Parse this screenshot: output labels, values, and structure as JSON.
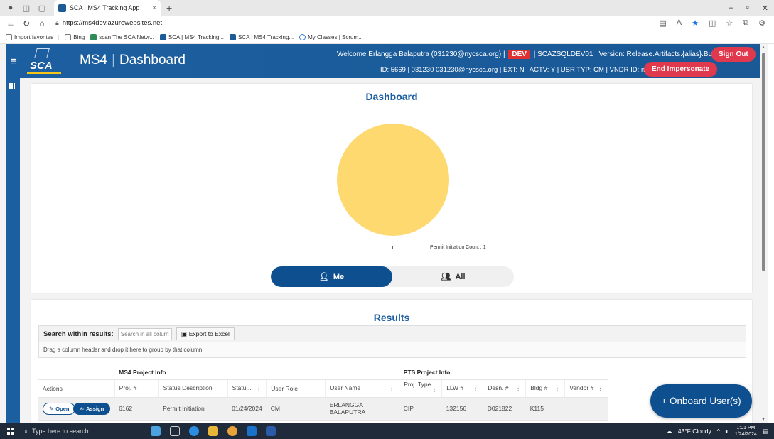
{
  "browser": {
    "tab_title": "SCA | MS4 Tracking App",
    "tab_close": "×",
    "new_tab": "+",
    "url": "https://ms4dev.azurewebsites.net",
    "favorites": [
      {
        "label": "Import favorites"
      },
      {
        "label": "Bing"
      },
      {
        "label": "scan The SCA Netw..."
      },
      {
        "label": "SCA | MS4 Tracking..."
      },
      {
        "label": "SCA | MS4 Tracking..."
      },
      {
        "label": "My Classes | Scrum..."
      }
    ]
  },
  "header": {
    "brand_left": "MS4",
    "brand_sep": "|",
    "brand_right": "Dashboard",
    "logo_text": "SCA",
    "welcome_pre": "Welcome Erlangga Balaputra (031230@nycsca.org) |",
    "env_badge": "DEV",
    "welcome_post": "| SCAZSQLDEV01 | Version: Release.Artifacts.{alias}.BuildNumber",
    "id_line": "ID: 5669 | 031230 031230@nycsca.org | EXT: N | ACTV: Y | USR TYP: CM | VNDR ID: null",
    "sign_out": "Sign Out",
    "end_impersonate": "End Impersonate"
  },
  "dashboard": {
    "title": "Dashboard",
    "toggle_me": "Me",
    "toggle_all": "All"
  },
  "chart_data": {
    "type": "pie",
    "title": "",
    "slices": [
      {
        "label": "Permit Initiation Count : 1",
        "value": 1,
        "color": "#fdd96f"
      }
    ]
  },
  "results": {
    "title": "Results",
    "search_label": "Search within results:",
    "search_placeholder": "Search in all columns",
    "export_label": "Export to Excel",
    "group_hint": "Drag a column header and drop it here to group by that column",
    "group_ms4": "MS4 Project Info",
    "group_pts": "PTS Project Info",
    "columns": [
      "Actions",
      "Proj. #",
      "Status Description",
      "Statu...",
      "User Role",
      "User Name",
      "Proj. Type",
      "LLW #",
      "Desn. #",
      "Bldg #",
      "Vendor #"
    ],
    "rows": [
      {
        "open_label": "Open",
        "assign_label": "Assign",
        "proj": "6162",
        "status_desc": "Permit Initiation",
        "status_date": "01/24/2024",
        "user_role": "CM",
        "user_name": "ERLANGGA BALAPUTRA",
        "proj_type": "CIP",
        "llw": "132156",
        "desn": "D021822",
        "bldg": "K115",
        "vendor": ""
      }
    ]
  },
  "onboard_button": "+ Onboard User(s)",
  "taskbar": {
    "search_placeholder": "Type here to search",
    "weather": "43°F Cloudy",
    "time": "1:01 PM",
    "date": "1/24/2024"
  },
  "colors": {
    "brand_blue": "#1c5fa0",
    "dark_blue": "#0d4f8f",
    "accent_red": "#e0394e",
    "pie_yellow": "#fdd96f"
  }
}
